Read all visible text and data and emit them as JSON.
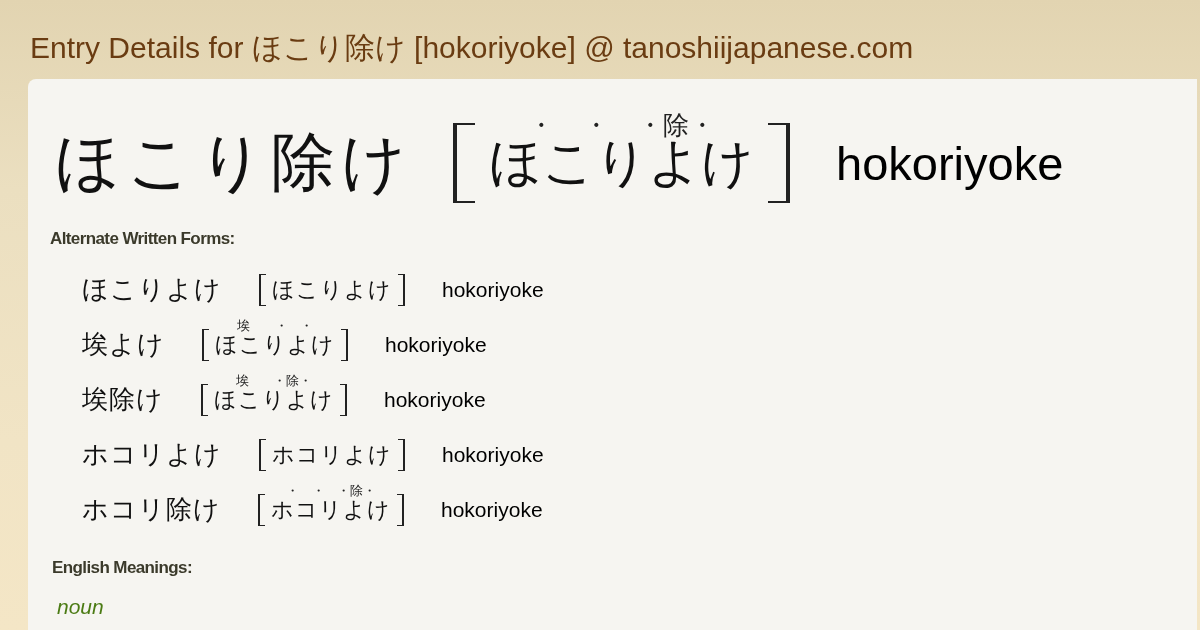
{
  "page_title": "Entry Details for ほこり除け [hokoriyoke] @ tanoshiijapanese.com",
  "entry": {
    "written": "ほこり除け",
    "reading": {
      "kana": "ほこりよけ",
      "ruby": "・ ・ ・除・"
    },
    "romaji": "hokoriyoke"
  },
  "alternate_forms": {
    "heading": "Alternate Written Forms:",
    "items": [
      {
        "written": "ほこりよけ",
        "reading": {
          "kana": "ほこりよけ"
        },
        "romaji": "hokoriyoke"
      },
      {
        "written": "埃よけ",
        "reading": {
          "kana": "ほこりよけ",
          "ruby": "埃  ・ ・"
        },
        "romaji": "hokoriyoke"
      },
      {
        "written": "埃除け",
        "reading": {
          "kana": "ほこりよけ",
          "ruby": "埃  ・除・"
        },
        "romaji": "hokoriyoke"
      },
      {
        "written": "ホコリよけ",
        "reading": {
          "kana": "ホコリよけ"
        },
        "romaji": "hokoriyoke"
      },
      {
        "written": "ホコリ除け",
        "reading": {
          "kana": "ホコリよけ",
          "ruby": "・ ・ ・除・"
        },
        "romaji": "hokoriyoke"
      }
    ]
  },
  "english_meanings": {
    "heading": "English Meanings:",
    "part_of_speech": "noun"
  }
}
